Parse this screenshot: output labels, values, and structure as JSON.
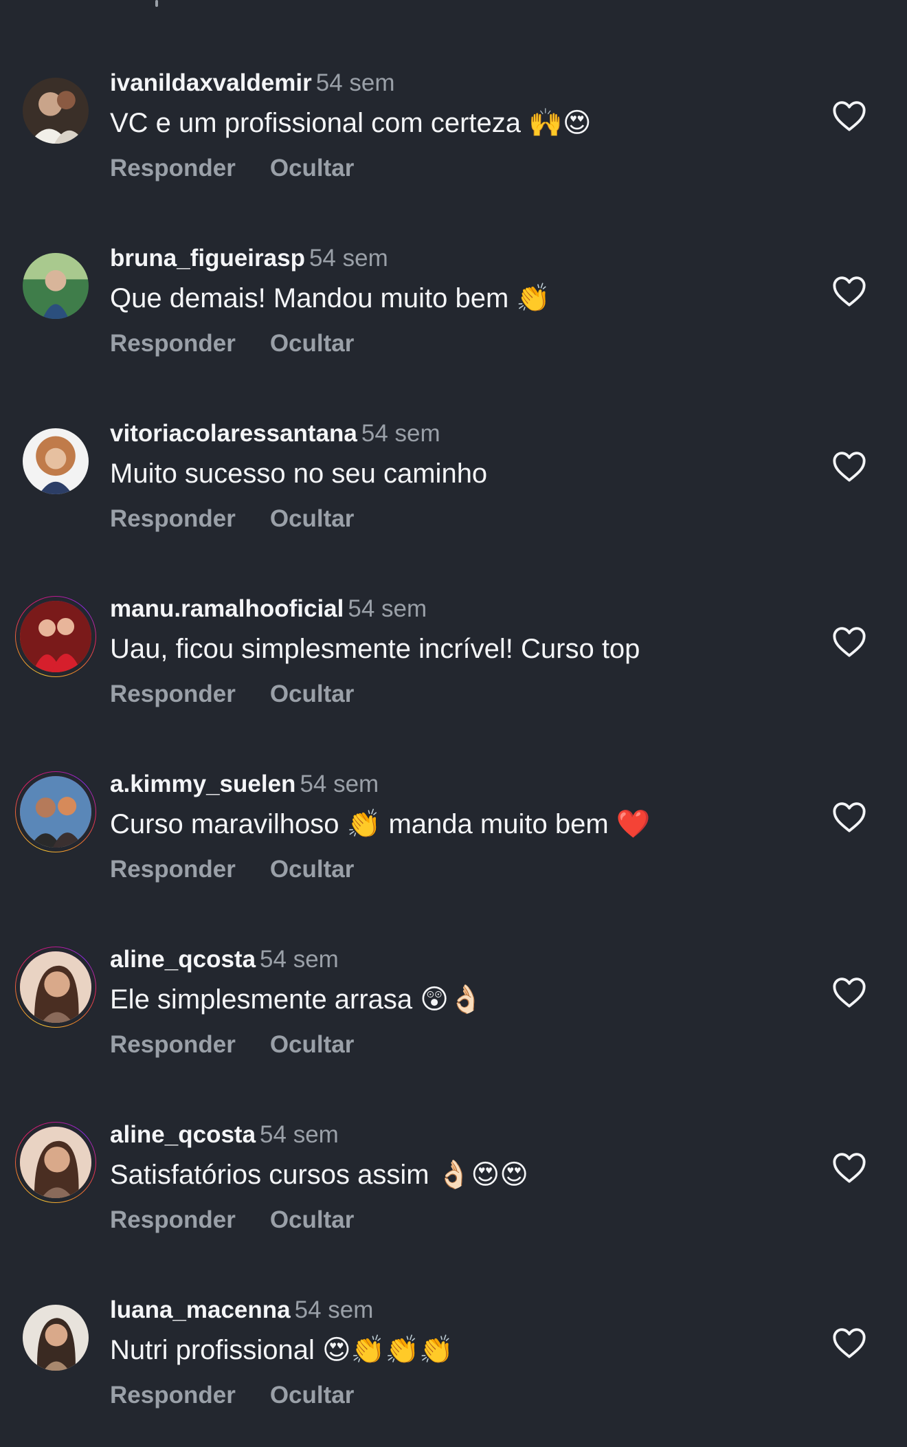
{
  "comments": [
    {
      "username": "ivanildaxvaldemir",
      "time": "54 sem",
      "text": "VC e um profissional com certeza 🙌😍",
      "reply": "Responder",
      "hide": "Ocultar",
      "story_ring": false,
      "avatar_colors": [
        "#3a2f28",
        "#c9a48a",
        "#f1efe9"
      ]
    },
    {
      "username": "bruna_figueirasp",
      "time": "54 sem",
      "text": "Que demais! Mandou muito bem 👏",
      "reply": "Responder",
      "hide": "Ocultar",
      "story_ring": false,
      "avatar_colors": [
        "#3f7d4a",
        "#a9c98e",
        "#2b4f7d"
      ]
    },
    {
      "username": "vitoriacolaressantana",
      "time": "54 sem",
      "text": "Muito sucesso no seu caminho",
      "reply": "Responder",
      "hide": "Ocultar",
      "story_ring": false,
      "avatar_colors": [
        "#f3f3f3",
        "#c07b4a",
        "#2c3e66"
      ]
    },
    {
      "username": "manu.ramalhooficial",
      "time": "54 sem",
      "text": "Uau, ficou simplesmente incrível! Curso top",
      "reply": "Responder",
      "hide": "Ocultar",
      "story_ring": true,
      "avatar_colors": [
        "#7a1a1a",
        "#d61f2c",
        "#e8b59a"
      ]
    },
    {
      "username": "a.kimmy_suelen",
      "time": "54 sem",
      "text": "Curso maravilhoso 👏 manda muito bem ❤️",
      "reply": "Responder",
      "hide": "Ocultar",
      "story_ring": true,
      "avatar_colors": [
        "#5a87b8",
        "#2a2a2a",
        "#d68a5a"
      ]
    },
    {
      "username": "aline_qcosta",
      "time": "54 sem",
      "text": "Ele simplesmente arrasa 😲👌🏻",
      "reply": "Responder",
      "hide": "Ocultar",
      "story_ring": true,
      "avatar_colors": [
        "#8a6a5a",
        "#e9d3c3",
        "#4a2e22"
      ]
    },
    {
      "username": "aline_qcosta",
      "time": "54 sem",
      "text": "Satisfatórios cursos assim 👌🏻😍😍",
      "reply": "Responder",
      "hide": "Ocultar",
      "story_ring": true,
      "avatar_colors": [
        "#8a6a5a",
        "#e9d3c3",
        "#4a2e22"
      ]
    },
    {
      "username": "luana_macenna",
      "time": "54 sem",
      "text": "Nutri profissional 😍👏👏👏",
      "reply": "Responder",
      "hide": "Ocultar",
      "story_ring": false,
      "avatar_colors": [
        "#e8e3dc",
        "#3a2a22",
        "#d9a98a"
      ]
    }
  ],
  "theme": {
    "background": "#23272f",
    "text": "#f4f5f7",
    "muted": "#9aa0a8"
  },
  "icons": {
    "like": "heart-outline-icon"
  }
}
